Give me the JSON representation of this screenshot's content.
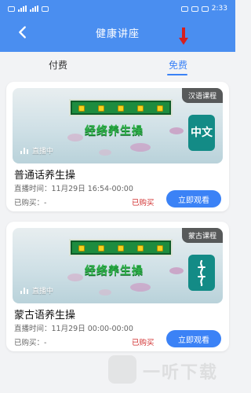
{
  "statusbar": {
    "time": "2:33"
  },
  "header": {
    "title": "健康讲座",
    "back_icon": "chevron-left-icon",
    "bg_color": "#4a8ef0"
  },
  "tabs": [
    {
      "label": "付费",
      "active": false
    },
    {
      "label": "免费",
      "active": true
    }
  ],
  "cards": [
    {
      "tag": "汉语课程",
      "badge_text": "中文",
      "live_text": "直播中",
      "thumb_title": "经络养生操",
      "title": "普通话养生操",
      "time_label": "直播时间：",
      "time_value": "11月29日 16:54-00:00",
      "bought_label": "已购买：",
      "bought_value": "-",
      "status": "已购买",
      "button": "立即观看"
    },
    {
      "tag": "蒙古课程",
      "badge_text": "",
      "live_text": "直播中",
      "thumb_title": "经络养生操",
      "title": "蒙古语养生操",
      "time_label": "直播时间：",
      "time_value": "11月29日 00:00-00:00",
      "bought_label": "已购买：",
      "bought_value": "-",
      "status": "已购买",
      "button": "立即观看"
    }
  ],
  "watermark": {
    "text": "一听下载"
  },
  "colors": {
    "accent": "#3b82f6",
    "status_red": "#d12c2c"
  }
}
